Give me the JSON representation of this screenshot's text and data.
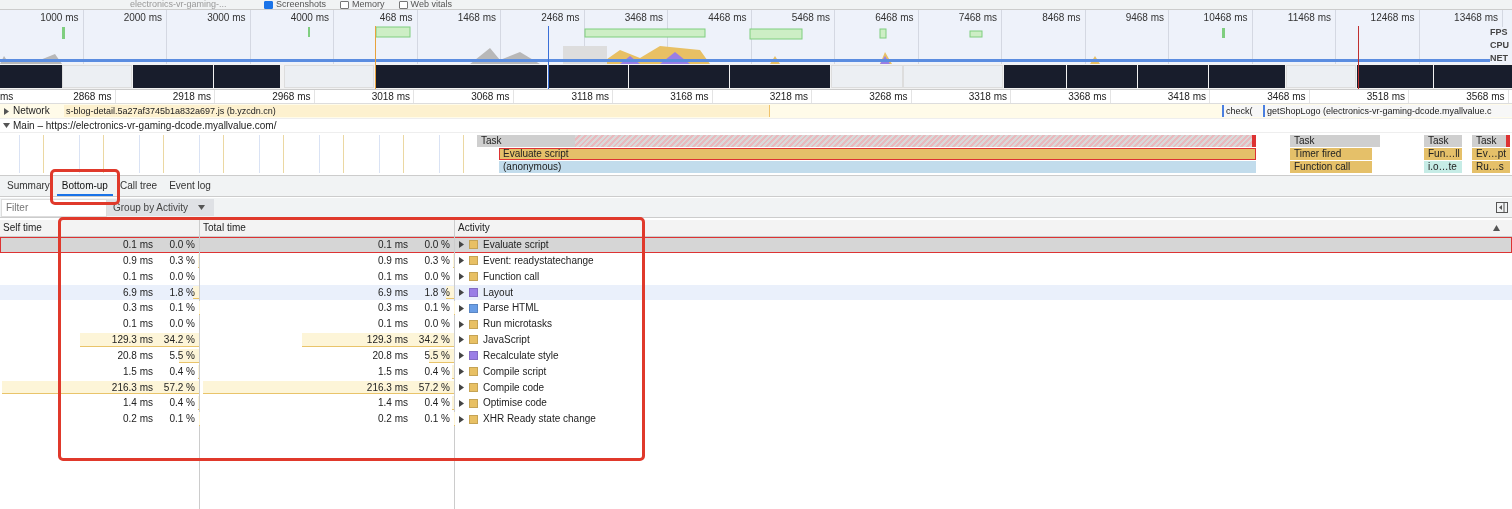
{
  "toolbar": {
    "recording": "electronics-vr-gaming-...",
    "checkboxes": [
      {
        "label": "Screenshots",
        "checked": true
      },
      {
        "label": "Memory",
        "checked": false
      },
      {
        "label": "Web vitals",
        "checked": false
      }
    ]
  },
  "overview": {
    "ticks": [
      "1000 ms",
      "2000 ms",
      "3000 ms",
      "4000 ms",
      "468 ms",
      "1468 ms",
      "2468 ms",
      "3468 ms",
      "4468 ms",
      "5468 ms",
      "6468 ms",
      "7468 ms",
      "8468 ms",
      "9468 ms",
      "10468 ms",
      "11468 ms",
      "12468 ms",
      "13468 ms"
    ],
    "track_labels": [
      "FPS",
      "CPU",
      "NET"
    ]
  },
  "ruler": [
    "ms",
    "2868 ms",
    "2918 ms",
    "2968 ms",
    "3018 ms",
    "3068 ms",
    "3118 ms",
    "3168 ms",
    "3218 ms",
    "3268 ms",
    "3318 ms",
    "3368 ms",
    "3418 ms",
    "3468 ms",
    "3518 ms",
    "3568 ms"
  ],
  "network": {
    "label": "Network",
    "expanded": false,
    "requests": [
      "s-blog-detail.5a27af3745b1a832a697.js (b.yzcdn.cn)",
      "check(",
      "getShopLogo (electronics-vr-gaming-dcode.myallvalue.c"
    ]
  },
  "main": {
    "label": "Main – https://electronics-vr-gaming-dcode.myallvalue.com/",
    "expanded": true
  },
  "flame": [
    {
      "label": "Task",
      "kind": "task",
      "long": true,
      "selected": false
    },
    {
      "label": "Evaluate script",
      "kind": "script",
      "long": false,
      "selected": true
    },
    {
      "label": "(anonymous)",
      "kind": "anon",
      "long": false,
      "selected": false
    },
    {
      "label": "Task",
      "kind": "task",
      "long": false,
      "selected": false
    },
    {
      "label": "Timer fired",
      "kind": "script",
      "long": false,
      "selected": false
    },
    {
      "label": "Function call",
      "kind": "script",
      "long": false,
      "selected": false
    },
    {
      "label": "Task",
      "kind": "task",
      "long": false,
      "selected": false
    },
    {
      "label": "Fun…ll",
      "kind": "script",
      "long": false,
      "selected": false
    },
    {
      "label": "i.o…te",
      "kind": "mint",
      "long": false,
      "selected": false
    },
    {
      "label": "Task",
      "kind": "task",
      "long": true,
      "selected": false
    },
    {
      "label": "Ev…pt",
      "kind": "script",
      "long": false,
      "selected": false
    },
    {
      "label": "Ru…s",
      "kind": "script",
      "long": false,
      "selected": false
    }
  ],
  "tabs": [
    {
      "label": "Summary",
      "selected": false,
      "highlight_box": false
    },
    {
      "label": "Bottom-up",
      "selected": true,
      "highlight_box": true
    },
    {
      "label": "Call tree",
      "selected": false,
      "highlight_box": false
    },
    {
      "label": "Event log",
      "selected": false,
      "highlight_box": false
    }
  ],
  "filter": {
    "placeholder": "Filter"
  },
  "group_by": "Group by Activity",
  "table": {
    "highlight_box": true,
    "columns": [
      "Self time",
      "Total time",
      "Activity"
    ],
    "rows": [
      {
        "self": "0.1 ms",
        "self_pct": "0.0 %",
        "total": "0.1 ms",
        "total_pct": "0.0 %",
        "activity": "Evaluate script",
        "color": "#e8c064",
        "selected": true,
        "hovered": false
      },
      {
        "self": "0.9 ms",
        "self_pct": "0.3 %",
        "total": "0.9 ms",
        "total_pct": "0.3 %",
        "activity": "Event: readystatechange",
        "color": "#e8c064",
        "level": 0.005,
        "selected": false,
        "hovered": false
      },
      {
        "self": "0.1 ms",
        "self_pct": "0.0 %",
        "total": "0.1 ms",
        "total_pct": "0.0 %",
        "activity": "Function call",
        "color": "#e8c064",
        "selected": false,
        "hovered": false
      },
      {
        "self": "6.9 ms",
        "self_pct": "1.8 %",
        "total": "6.9 ms",
        "total_pct": "1.8 %",
        "activity": "Layout",
        "color": "#9a7ee6",
        "level": 0.03,
        "selected": false,
        "hovered": true
      },
      {
        "self": "0.3 ms",
        "self_pct": "0.1 %",
        "total": "0.3 ms",
        "total_pct": "0.1 %",
        "activity": "Parse HTML",
        "color": "#6a9ee6",
        "level": 0.002,
        "selected": false,
        "hovered": false
      },
      {
        "self": "0.1 ms",
        "self_pct": "0.0 %",
        "total": "0.1 ms",
        "total_pct": "0.0 %",
        "activity": "Run microtasks",
        "color": "#e8c064",
        "selected": false,
        "hovered": false
      },
      {
        "self": "129.3 ms",
        "self_pct": "34.2 %",
        "total": "129.3 ms",
        "total_pct": "34.2 %",
        "activity": "JavaScript",
        "color": "#e8c064",
        "level": 0.6,
        "selected": false,
        "hovered": false
      },
      {
        "self": "20.8 ms",
        "self_pct": "5.5 %",
        "total": "20.8 ms",
        "total_pct": "5.5 %",
        "activity": "Recalculate style",
        "color": "#9a7ee6",
        "level": 0.1,
        "selected": false,
        "hovered": false
      },
      {
        "self": "1.5 ms",
        "self_pct": "0.4 %",
        "total": "1.5 ms",
        "total_pct": "0.4 %",
        "activity": "Compile script",
        "color": "#e8c064",
        "level": 0.007,
        "selected": false,
        "hovered": false
      },
      {
        "self": "216.3 ms",
        "self_pct": "57.2 %",
        "total": "216.3 ms",
        "total_pct": "57.2 %",
        "activity": "Compile code",
        "color": "#e8c064",
        "level": 0.99,
        "selected": false,
        "hovered": false
      },
      {
        "self": "1.4 ms",
        "self_pct": "0.4 %",
        "total": "1.4 ms",
        "total_pct": "0.4 %",
        "activity": "Optimise code",
        "color": "#e8c064",
        "level": 0.007,
        "selected": false,
        "hovered": false
      },
      {
        "self": "0.2 ms",
        "self_pct": "0.1 %",
        "total": "0.2 ms",
        "total_pct": "0.1 %",
        "activity": "XHR Ready state change",
        "color": "#e8c064",
        "level": 0.002,
        "selected": false,
        "hovered": false
      }
    ]
  }
}
